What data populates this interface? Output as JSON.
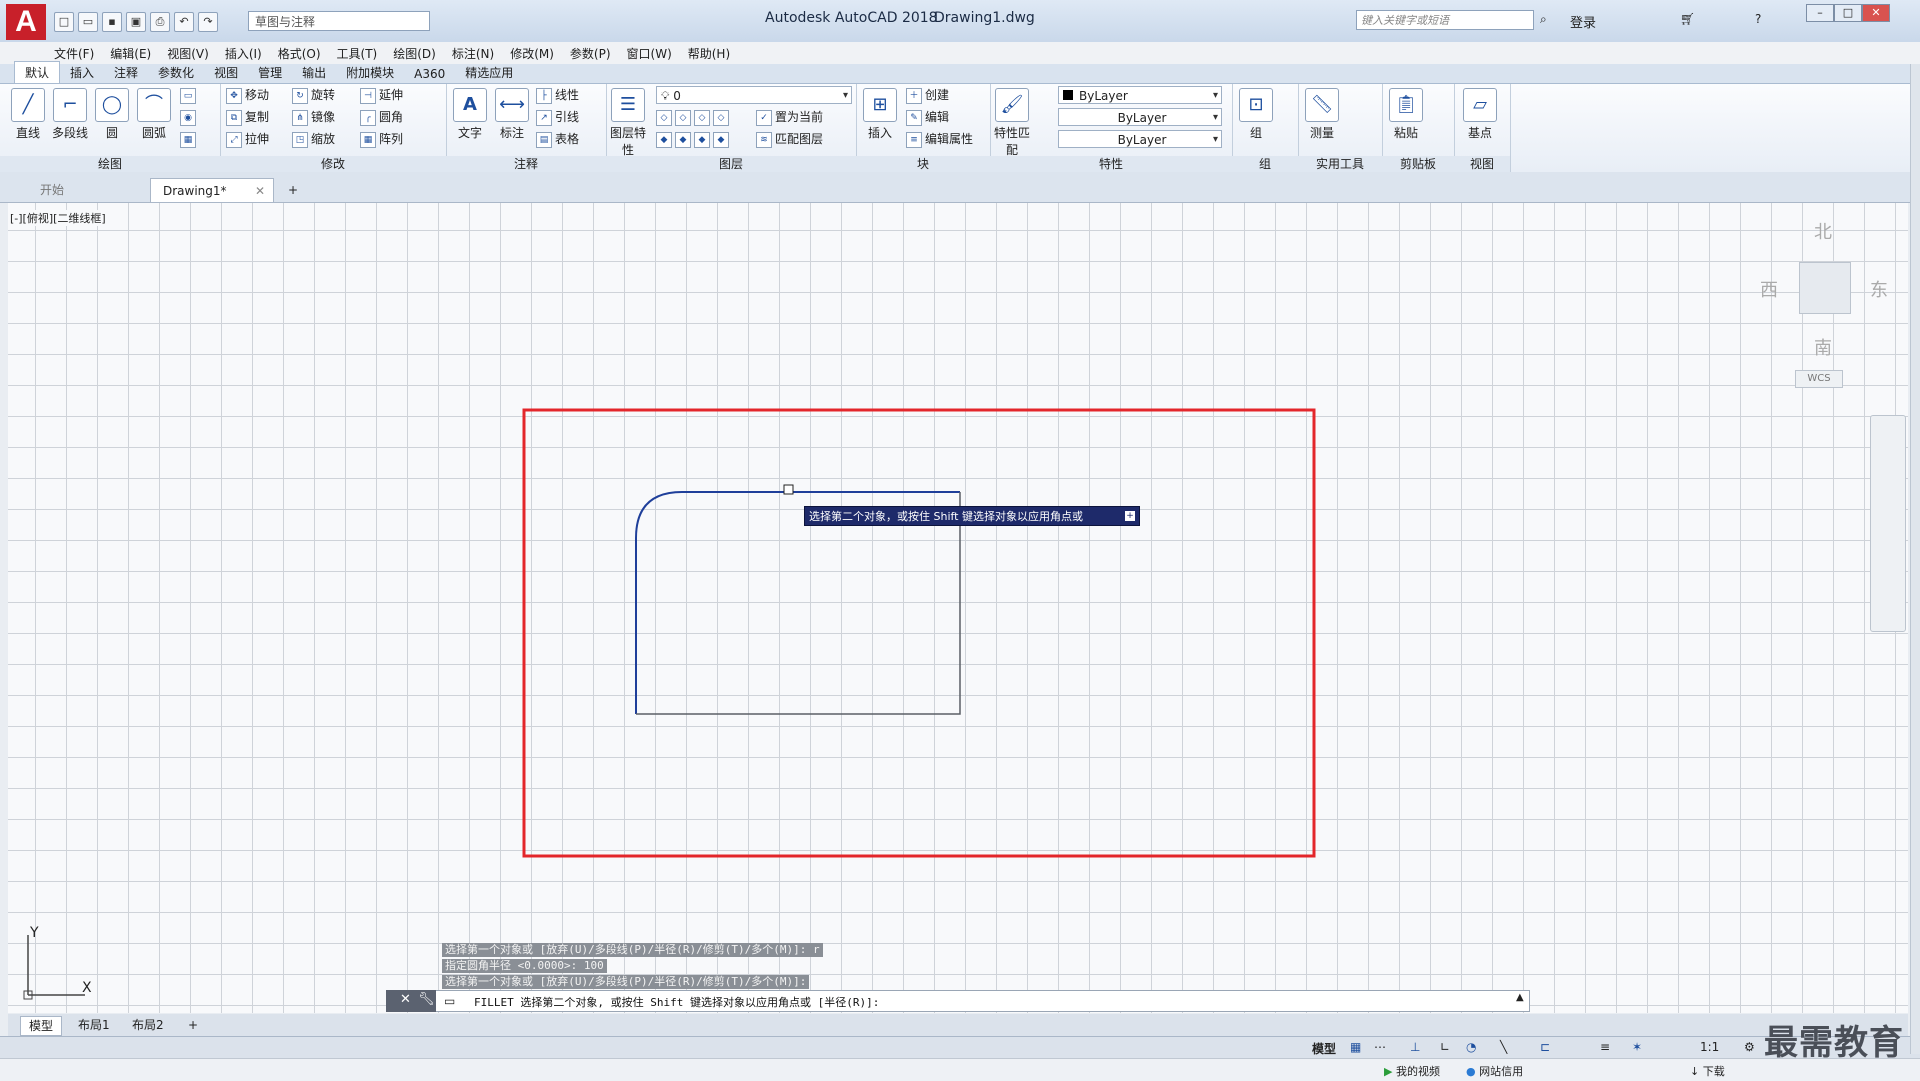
{
  "app": {
    "logo": "A",
    "title": "Autodesk AutoCAD 2018",
    "file": "Drawing1.dwg",
    "workspace": "草图与注释",
    "search_placeholder": "键入关键字或短语",
    "login": "登录"
  },
  "menu": [
    "文件(F)",
    "编辑(E)",
    "视图(V)",
    "插入(I)",
    "格式(O)",
    "工具(T)",
    "绘图(D)",
    "标注(N)",
    "修改(M)",
    "参数(P)",
    "窗口(W)",
    "帮助(H)"
  ],
  "ribbon_tabs": [
    "默认",
    "插入",
    "注释",
    "参数化",
    "视图",
    "管理",
    "输出",
    "附加模块",
    "A360",
    "精选应用"
  ],
  "ribbon": {
    "draw": {
      "title": "绘图",
      "line": "直线",
      "polyline": "多段线",
      "circle": "圆",
      "arc": "圆弧"
    },
    "modify": {
      "title": "修改",
      "move": "移动",
      "rotate": "旋转",
      "trim": "延伸",
      "copy": "复制",
      "mirror": "镜像",
      "fillet": "圆角",
      "stretch": "拉伸",
      "scale": "缩放",
      "array": "阵列"
    },
    "annotation": {
      "title": "注释",
      "text": "文字",
      "dimension": "标注",
      "linear": "线性",
      "leader": "引线",
      "table": "表格"
    },
    "layers": {
      "title": "图层",
      "layer_props": "图层特性",
      "layer_name": "0",
      "set_current": "置为当前",
      "match_layer": "匹配图层"
    },
    "block": {
      "title": "块",
      "insert": "插入",
      "create": "创建",
      "edit": "编辑",
      "edit_attr": "编辑属性"
    },
    "properties": {
      "title": "特性",
      "match": "特性匹配",
      "color": "ByLayer",
      "linetype": "ByLayer",
      "lineweight": "ByLayer"
    },
    "groups": {
      "title": "组",
      "group": "组"
    },
    "utilities": {
      "title": "实用工具",
      "measure": "测量"
    },
    "clipboard": {
      "title": "剪贴板",
      "paste": "粘贴"
    },
    "view": {
      "title": "视图",
      "base": "基点"
    }
  },
  "doc_tabs": [
    "开始",
    "Drawing1*"
  ],
  "viewport_label": "[-][俯视][二维线框]",
  "viewcube": {
    "north": "北",
    "south": "南",
    "east": "东",
    "west": "西",
    "wcs": "WCS"
  },
  "tooltip": "选择第二个对象，或按住 Shift 键选择对象以应用角点或",
  "command_history": [
    "选择第一个对象或 [放弃(U)/多段线(P)/半径(R)/修剪(T)/多个(M)]: r",
    "指定圆角半径 <0.0000>: 100",
    "选择第一个对象或 [放弃(U)/多段线(P)/半径(R)/修剪(T)/多个(M)]:"
  ],
  "command_line": "FILLET 选择第二个对象, 或按住 Shift 键选择对象以应用角点或 [半径(R)]:",
  "layout_tabs": [
    "模型",
    "布局1",
    "布局2"
  ],
  "status": {
    "model": "模型",
    "scale": "1:1"
  },
  "taskbar": {
    "video": "我的视频",
    "net": "网站信用",
    "download": "下载"
  },
  "watermark": "最需教育",
  "ucs": {
    "x": "X",
    "y": "Y"
  },
  "colors": {
    "highlight_rect": "#e3262b",
    "shape": "#1f3f9a",
    "tooltip_bg": "#1e2a6a"
  }
}
